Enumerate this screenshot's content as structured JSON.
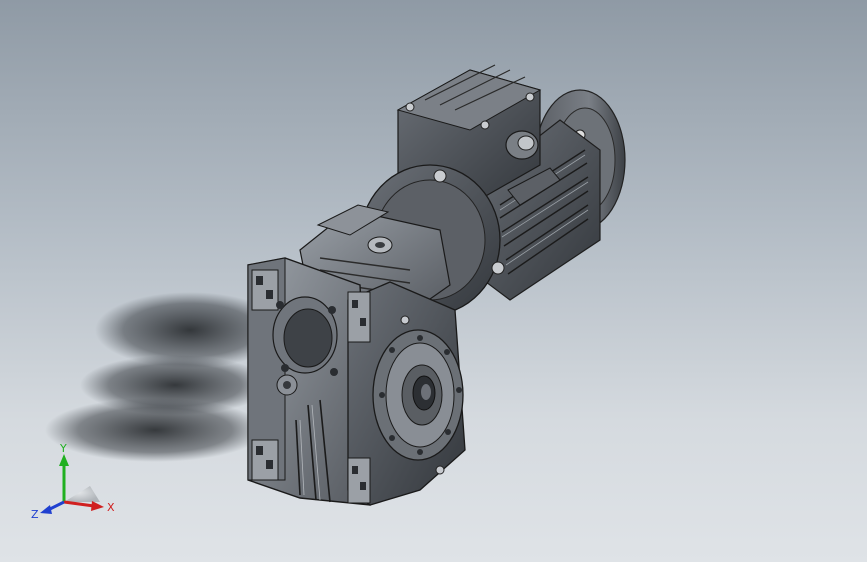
{
  "viewport": {
    "background_top": "#8f9aa5",
    "background_bottom": "#dfe3e7"
  },
  "model": {
    "icon": "worm-gear-motor-3d-model",
    "body_color": "#4f5359"
  },
  "triad": {
    "x_label": "X",
    "y_label": "Y",
    "z_label": "Z",
    "x_color": "#d02020",
    "y_color": "#20b020",
    "z_color": "#2040d0"
  }
}
